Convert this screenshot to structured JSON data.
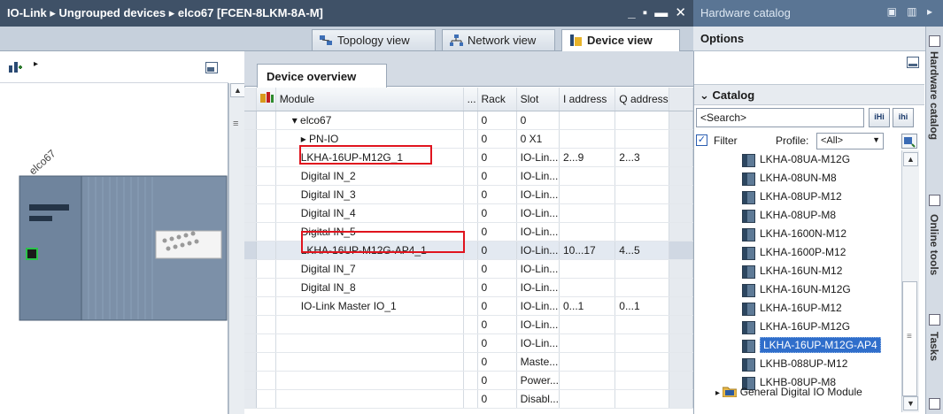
{
  "window": {
    "breadcrumb": "IO-Link ▸ Ungrouped devices ▸ elco67 [FCEN-8LKM-8A-M]",
    "controls": "_ ▪ ▬ ✕"
  },
  "view_tabs": [
    {
      "label": "Topology view"
    },
    {
      "label": "Network view"
    },
    {
      "label": "Device view"
    }
  ],
  "device_graphic": {
    "device_label": "elco67"
  },
  "overview": {
    "tab_label": "Device overview",
    "columns": [
      "Module",
      "...",
      "Rack",
      "Slot",
      "I address",
      "Q address"
    ],
    "rows": [
      {
        "module": "▾  elco67",
        "rack": "0",
        "slot": "0",
        "i": "",
        "q": ""
      },
      {
        "module": "▸  PN-IO",
        "rack": "0",
        "slot": "0 X1",
        "i": "",
        "q": ""
      },
      {
        "module": "LKHA-16UP-M12G_1",
        "rack": "0",
        "slot": "IO-Lin...",
        "i": "2...9",
        "q": "2...3"
      },
      {
        "module": "Digital IN_2",
        "rack": "0",
        "slot": "IO-Lin...",
        "i": "",
        "q": ""
      },
      {
        "module": "Digital IN_3",
        "rack": "0",
        "slot": "IO-Lin...",
        "i": "",
        "q": ""
      },
      {
        "module": "Digital IN_4",
        "rack": "0",
        "slot": "IO-Lin...",
        "i": "",
        "q": ""
      },
      {
        "module": "Digital IN_5",
        "rack": "0",
        "slot": "IO-Lin...",
        "i": "",
        "q": ""
      },
      {
        "module": "LKHA-16UP-M12G-AP4_1",
        "rack": "0",
        "slot": "IO-Lin...",
        "i": "10...17",
        "q": "4...5"
      },
      {
        "module": "Digital IN_7",
        "rack": "0",
        "slot": "IO-Lin...",
        "i": "",
        "q": ""
      },
      {
        "module": "Digital IN_8",
        "rack": "0",
        "slot": "IO-Lin...",
        "i": "",
        "q": ""
      },
      {
        "module": "IO-Link Master IO_1",
        "rack": "0",
        "slot": "IO-Lin...",
        "i": "0...1",
        "q": "0...1"
      },
      {
        "module": "",
        "rack": "0",
        "slot": "IO-Lin...",
        "i": "",
        "q": ""
      },
      {
        "module": "",
        "rack": "0",
        "slot": "IO-Lin...",
        "i": "",
        "q": ""
      },
      {
        "module": "",
        "rack": "0",
        "slot": "Maste...",
        "i": "",
        "q": ""
      },
      {
        "module": "",
        "rack": "0",
        "slot": "Power...",
        "i": "",
        "q": ""
      },
      {
        "module": "",
        "rack": "0",
        "slot": "Disabl...",
        "i": "",
        "q": ""
      }
    ]
  },
  "catalog": {
    "title": "Hardware catalog",
    "options_label": "Options",
    "catalog_label": "Catalog",
    "search_placeholder": "<Search>",
    "filter_label": "Filter",
    "profile_label": "Profile:",
    "profile_value": "<All>",
    "items": [
      "LKHA-08UA-M12G",
      "LKHA-08UN-M8",
      "LKHA-08UP-M12",
      "LKHA-08UP-M8",
      "LKHA-1600N-M12",
      "LKHA-1600P-M12",
      "LKHA-16UN-M12",
      "LKHA-16UN-M12G",
      "LKHA-16UP-M12",
      "LKHA-16UP-M12G",
      "LKHA-16UP-M12G-AP4",
      "LKHB-088UP-M12",
      "LKHB-08UP-M8"
    ],
    "selected_item": "LKHA-16UP-M12G-AP4",
    "folder": "General Digital IO Module"
  },
  "side_tabs": [
    "Hardware catalog",
    "Online tools",
    "Tasks"
  ]
}
